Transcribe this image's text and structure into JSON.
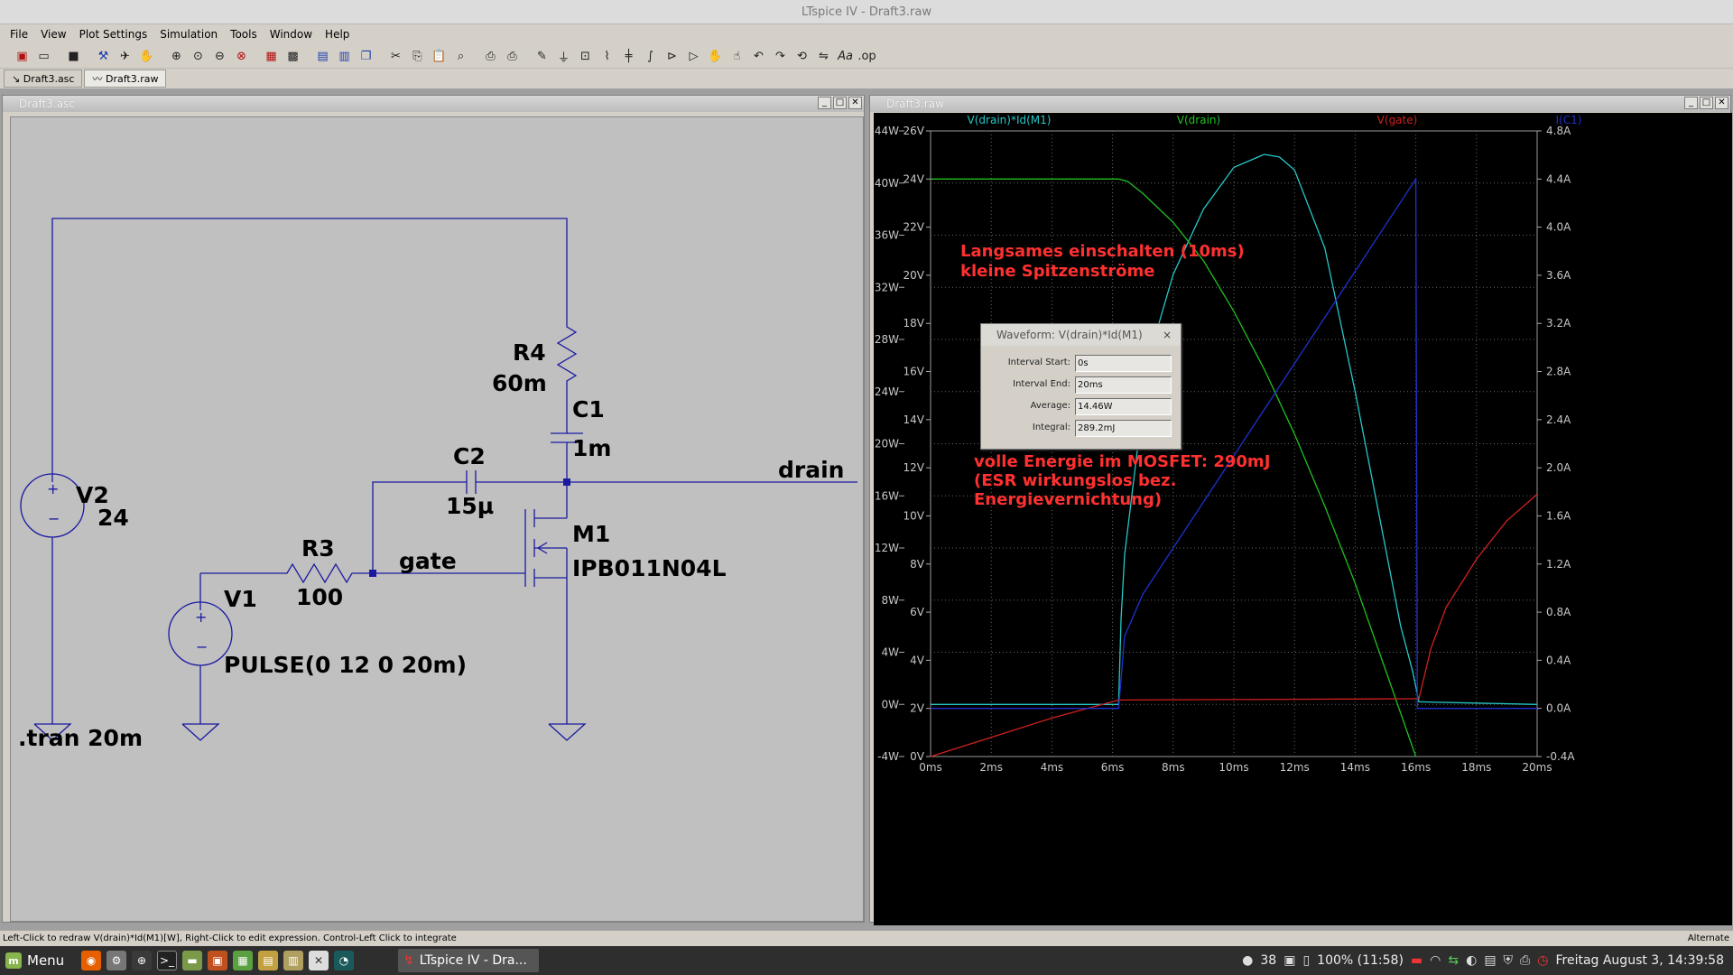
{
  "window": {
    "title": "LTspice IV - Draft3.raw"
  },
  "menu": [
    "File",
    "View",
    "Plot Settings",
    "Simulation",
    "Tools",
    "Window",
    "Help"
  ],
  "toolbar": {
    "icons": [
      "new-schematic-icon",
      "open-icon",
      "save-icon",
      "control-panel-icon",
      "run-icon",
      "halt-icon",
      "zoom-in-icon",
      "zoom-pan-icon",
      "zoom-out-icon",
      "zoom-fit-icon",
      "autorange-icon",
      "grid-icon",
      "tile-horizontal-icon",
      "tile-vertical-icon",
      "cascade-icon",
      "cut-icon",
      "copy-icon",
      "paste-icon",
      "find-icon",
      "print-preview-icon",
      "print-icon",
      "wire-icon",
      "ground-icon",
      "label-icon",
      "resistor-icon",
      "capacitor-icon",
      "inductor-icon",
      "diode-icon",
      "component-icon",
      "move-icon",
      "drag-icon",
      "undo-icon",
      "redo-icon",
      "rotate-icon",
      "mirror-icon",
      "text-icon",
      "spice-directive-icon"
    ]
  },
  "tabs": [
    {
      "label": "Draft3.asc"
    },
    {
      "label": "Draft3.raw"
    }
  ],
  "schematic_window": {
    "title": "Draft3.asc"
  },
  "plot_window": {
    "title": "Draft3.raw"
  },
  "schematic": {
    "r4": {
      "name": "R4",
      "value": "60m"
    },
    "c1": {
      "name": "C1",
      "value": "1m"
    },
    "c2": {
      "name": "C2",
      "value": "15µ"
    },
    "v2": {
      "name": "V2",
      "value": "24"
    },
    "r3": {
      "name": "R3",
      "value": "100"
    },
    "v1": {
      "name": "V1",
      "value": "PULSE(0 12 0 20m)"
    },
    "m1": {
      "name": "M1",
      "value": "IPB011N04L"
    },
    "net_drain": "drain",
    "net_gate": "gate",
    "directive": ".tran 20m",
    "wire_color": "#0000a0"
  },
  "chart_data": {
    "type": "line",
    "x_ticks": [
      "0ms",
      "2ms",
      "4ms",
      "6ms",
      "8ms",
      "10ms",
      "12ms",
      "14ms",
      "16ms",
      "18ms",
      "20ms"
    ],
    "xlim": [
      0,
      20
    ],
    "axis_left1": {
      "ticks": [
        "-4W",
        "0W",
        "4W",
        "8W",
        "12W",
        "16W",
        "20W",
        "24W",
        "28W",
        "32W",
        "36W",
        "40W",
        "44W"
      ],
      "range": [
        -4,
        44
      ]
    },
    "axis_left2": {
      "ticks": [
        "0V",
        "2V",
        "4V",
        "6V",
        "8V",
        "10V",
        "12V",
        "14V",
        "16V",
        "18V",
        "20V",
        "22V",
        "24V",
        "26V"
      ],
      "range": [
        0,
        26
      ]
    },
    "axis_right": {
      "ticks": [
        "-0.4A",
        "0.0A",
        "0.4A",
        "0.8A",
        "1.2A",
        "1.6A",
        "2.0A",
        "2.4A",
        "2.8A",
        "3.2A",
        "3.6A",
        "4.0A",
        "4.4A",
        "4.8A"
      ],
      "range": [
        -0.4,
        4.8
      ]
    },
    "grid": true,
    "background": "#000000",
    "series": [
      {
        "name": "V(drain)*Id(M1)",
        "color": "#26c8c8",
        "axis": "W",
        "x": [
          0,
          6.2,
          6.28,
          6.4,
          7.0,
          7.5,
          8.0,
          9.0,
          10.0,
          11.0,
          11.5,
          12.0,
          13.0,
          14.0,
          15.0,
          15.5,
          15.9,
          16.1,
          20
        ],
        "y": [
          0,
          0,
          6.5,
          11.5,
          23,
          29,
          33,
          38,
          41.2,
          42.2,
          42,
          41,
          35,
          24,
          12,
          6,
          2.5,
          0.2,
          0
        ]
      },
      {
        "name": "V(drain)",
        "color": "#20c020",
        "axis": "V",
        "x": [
          0,
          6.2,
          6.5,
          7.0,
          8.0,
          9.0,
          10.0,
          11.0,
          12.0,
          13.0,
          14.0,
          15.0,
          16.0
        ],
        "y": [
          24,
          24,
          23.9,
          23.4,
          22.2,
          20.6,
          18.5,
          16.1,
          13.4,
          10.4,
          7.2,
          3.6,
          0
        ]
      },
      {
        "name": "V(gate)",
        "color": "#d02020",
        "axis": "V",
        "x": [
          0,
          2,
          4,
          6.2,
          6.3,
          16,
          16.1,
          16.5,
          17,
          18,
          19,
          20
        ],
        "y": [
          0,
          0.8,
          1.6,
          2.35,
          2.35,
          2.4,
          2.4,
          4.5,
          6.2,
          8.2,
          9.8,
          10.9
        ]
      },
      {
        "name": "I(C1)",
        "color": "#2030d0",
        "axis": "A",
        "x": [
          0,
          6.2,
          6.4,
          7.0,
          16.0,
          16.05,
          20
        ],
        "y": [
          0,
          0,
          0.6,
          0.95,
          4.4,
          0,
          0
        ]
      }
    ],
    "annotations": [
      "Langsames einschalten (10ms)",
      "kleine Spitzenströme",
      "volle Energie im MOSFET: 290mJ",
      "(ESR wirkungslos bez.",
      "Energievernichtung)"
    ]
  },
  "waveform_dialog": {
    "title": "Waveform: V(drain)*Id(M1)",
    "close": "×",
    "rows": [
      {
        "label": "Interval Start:",
        "value": "0s"
      },
      {
        "label": "Interval End:",
        "value": "20ms"
      },
      {
        "label": "Average:",
        "value": "14.46W"
      },
      {
        "label": "Integral:",
        "value": "289.2mJ"
      }
    ]
  },
  "statusbar": {
    "text": "Left-Click to redraw V(drain)*Id(M1)[W],  Right-Click to edit expression. Control-Left Click to integrate",
    "right": "Alternate"
  },
  "taskbar": {
    "menu_label": "Menu",
    "task_label": "LTspice IV - Dra...",
    "tray": {
      "badge": "38",
      "battery": "100% (11:58)",
      "clock": "Freitag August  3, 14:39:58"
    }
  }
}
